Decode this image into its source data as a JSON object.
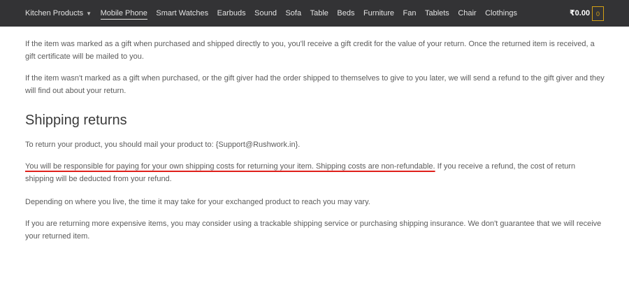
{
  "nav": {
    "items": [
      {
        "label": "Kitchen Products",
        "dropdown": true
      },
      {
        "label": "Mobile Phone",
        "active": true
      },
      {
        "label": "Smart Watches"
      },
      {
        "label": "Earbuds"
      },
      {
        "label": "Sound"
      },
      {
        "label": "Sofa"
      },
      {
        "label": "Table"
      },
      {
        "label": "Beds"
      },
      {
        "label": "Furniture"
      },
      {
        "label": "Fan"
      },
      {
        "label": "Tablets"
      },
      {
        "label": "Chair"
      },
      {
        "label": "Clothings"
      }
    ],
    "cart_total": "₹0.00",
    "cart_count": "0",
    "dropdown_icon": "chevron-down-icon"
  },
  "content": {
    "para1": "If the item was marked as a gift when purchased and shipped directly to you, you'll receive a gift credit for the value of your return. Once the returned item is received, a gift certificate will be mailed to you.",
    "para2": "If the item wasn't marked as a gift when purchased, or the gift giver had the order shipped to themselves to give to you later, we will send a refund to the gift giver and they will find out about your return.",
    "heading": "Shipping returns",
    "para3": "To return your product, you should mail your product to: {Support@Rushwork.in}.",
    "para4_underlined": "You will be responsible for paying for your own shipping costs for returning your item. Shipping costs are non-refundable.",
    "para4_rest": " If you receive a refund, the cost of return shipping will be deducted from your refund.",
    "para5": "Depending on where you live, the time it may take for your exchanged product to reach you may vary.",
    "para6": "If you are returning more expensive items, you may consider using a trackable shipping service or purchasing shipping insurance. We don't guarantee that we will receive your returned item."
  },
  "colors": {
    "nav_bg": "#333335",
    "accent": "#d4a014",
    "underline": "#e0201b"
  }
}
